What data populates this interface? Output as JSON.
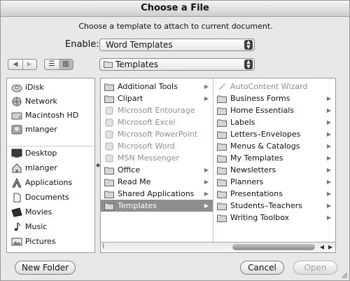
{
  "window": {
    "title": "Choose a File"
  },
  "prompt": "Choose a template to attach to current document.",
  "enable": {
    "label": "Enable:",
    "selected": "Word Templates"
  },
  "path": {
    "selected": "Templates"
  },
  "nav": {
    "back": "◀",
    "forward": "▶"
  },
  "view": {
    "list": "☰",
    "columns": "▥"
  },
  "sidebar": {
    "devices": [
      {
        "label": "iDisk",
        "icon": "idisk-icon"
      },
      {
        "label": "Network",
        "icon": "network-icon"
      },
      {
        "label": "Macintosh HD",
        "icon": "hard-disk-icon"
      },
      {
        "label": "mlanger",
        "icon": "user-icon"
      }
    ],
    "places": [
      {
        "label": "Desktop",
        "icon": "desktop-icon"
      },
      {
        "label": "mlanger",
        "icon": "home-icon"
      },
      {
        "label": "Applications",
        "icon": "applications-icon"
      },
      {
        "label": "Documents",
        "icon": "documents-icon"
      },
      {
        "label": "Movies",
        "icon": "movies-icon"
      },
      {
        "label": "Music",
        "icon": "music-icon"
      },
      {
        "label": "Pictures",
        "icon": "pictures-icon"
      }
    ]
  },
  "column1": [
    {
      "label": "Additional Tools",
      "icon": "folder-icon",
      "arrow": "▶",
      "state": "normal"
    },
    {
      "label": "Clipart",
      "icon": "folder-icon",
      "arrow": "▶",
      "state": "normal"
    },
    {
      "label": "Microsoft Entourage",
      "icon": "app-icon",
      "arrow": "",
      "state": "dim"
    },
    {
      "label": "Microsoft Excel",
      "icon": "app-icon",
      "arrow": "",
      "state": "dim"
    },
    {
      "label": "Microsoft PowerPoint",
      "icon": "app-icon",
      "arrow": "",
      "state": "dim"
    },
    {
      "label": "Microsoft Word",
      "icon": "app-icon",
      "arrow": "",
      "state": "dim"
    },
    {
      "label": "MSN Messenger",
      "icon": "app-icon",
      "arrow": "",
      "state": "dim"
    },
    {
      "label": "Office",
      "icon": "folder-icon",
      "arrow": "▶",
      "state": "normal"
    },
    {
      "label": "Read Me",
      "icon": "folder-icon",
      "arrow": "▶",
      "state": "normal"
    },
    {
      "label": "Shared Applications",
      "icon": "folder-icon",
      "arrow": "▶",
      "state": "normal"
    },
    {
      "label": "Templates",
      "icon": "folder-icon",
      "arrow": "▶",
      "state": "selected"
    }
  ],
  "column2": [
    {
      "label": "AutoContent Wizard",
      "icon": "wizard-icon",
      "arrow": "",
      "state": "dim"
    },
    {
      "label": "Business Forms",
      "icon": "folder-icon",
      "arrow": "▶",
      "state": "normal"
    },
    {
      "label": "Home Essentials",
      "icon": "folder-icon",
      "arrow": "▶",
      "state": "normal"
    },
    {
      "label": "Labels",
      "icon": "folder-icon",
      "arrow": "▶",
      "state": "normal"
    },
    {
      "label": "Letters–Envelopes",
      "icon": "folder-icon",
      "arrow": "▶",
      "state": "normal"
    },
    {
      "label": "Menus & Catalogs",
      "icon": "folder-icon",
      "arrow": "▶",
      "state": "normal"
    },
    {
      "label": "My Templates",
      "icon": "folder-icon",
      "arrow": "▶",
      "state": "normal"
    },
    {
      "label": "Newsletters",
      "icon": "folder-icon",
      "arrow": "▶",
      "state": "normal"
    },
    {
      "label": "Planners",
      "icon": "folder-icon",
      "arrow": "▶",
      "state": "normal"
    },
    {
      "label": "Presentations",
      "icon": "folder-icon",
      "arrow": "▶",
      "state": "normal"
    },
    {
      "label": "Students–Teachers",
      "icon": "folder-icon",
      "arrow": "▶",
      "state": "normal"
    },
    {
      "label": "Writing Toolbox",
      "icon": "folder-icon",
      "arrow": "▶",
      "state": "normal"
    }
  ],
  "scroll": {
    "left": "◀",
    "right": "▶"
  },
  "buttons": {
    "new_folder": "New Folder",
    "cancel": "Cancel",
    "open": "Open"
  }
}
